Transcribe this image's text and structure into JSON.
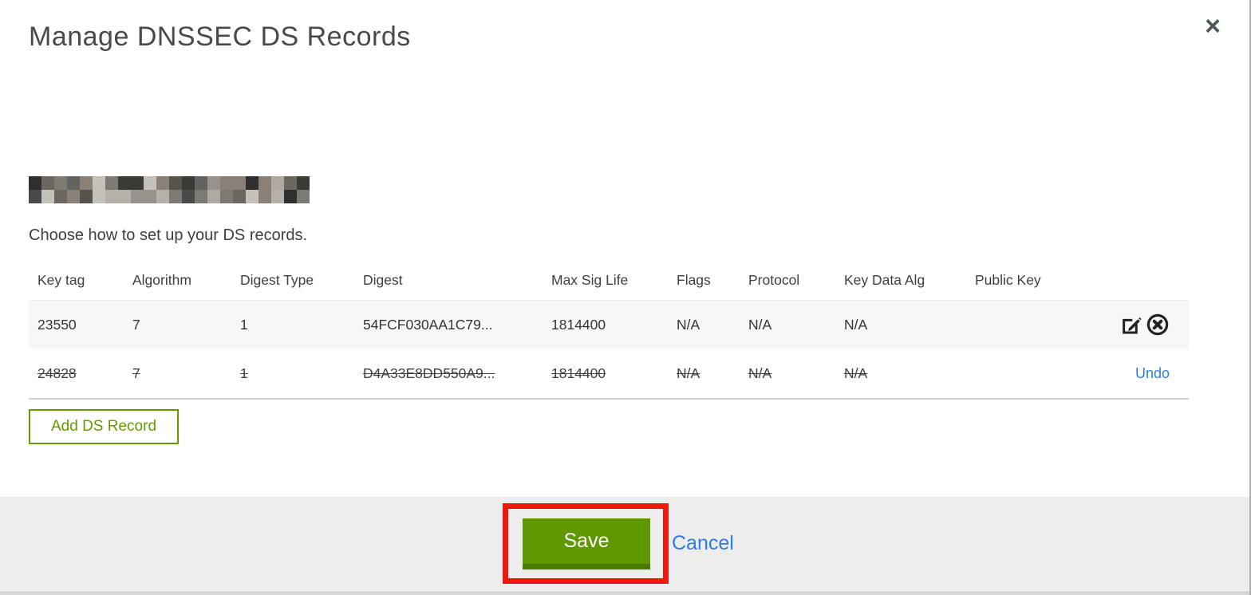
{
  "modal": {
    "title": "Manage DNSSEC DS Records",
    "close_icon": "×",
    "subtitle": "Choose how to set up your DS records.",
    "table": {
      "columns": [
        "Key tag",
        "Algorithm",
        "Digest Type",
        "Digest",
        "Max Sig Life",
        "Flags",
        "Protocol",
        "Key Data Alg",
        "Public Key"
      ],
      "rows": [
        {
          "key_tag": "23550",
          "algorithm": "7",
          "digest_type": "1",
          "digest": "54FCF030AA1C79...",
          "max_sig_life": "1814400",
          "flags": "N/A",
          "protocol": "N/A",
          "key_data_alg": "N/A",
          "public_key": "",
          "state": "normal"
        },
        {
          "key_tag": "24828",
          "algorithm": "7",
          "digest_type": "1",
          "digest": "D4A33E8DD550A9...",
          "max_sig_life": "1814400",
          "flags": "N/A",
          "protocol": "N/A",
          "key_data_alg": "N/A",
          "public_key": "",
          "state": "deleted",
          "undo_label": "Undo"
        }
      ]
    },
    "add_button_label": "Add DS Record",
    "footer": {
      "save_label": "Save",
      "cancel_label": "Cancel"
    }
  },
  "colors": {
    "accent_green": "#669900",
    "save_green": "#5f9700",
    "save_green_dark": "#4b7a00",
    "link_blue": "#2e7de4",
    "annotation_red": "#ec1a0e",
    "row_stripe": "#f7f7f7",
    "footer_bg": "#ededed"
  }
}
